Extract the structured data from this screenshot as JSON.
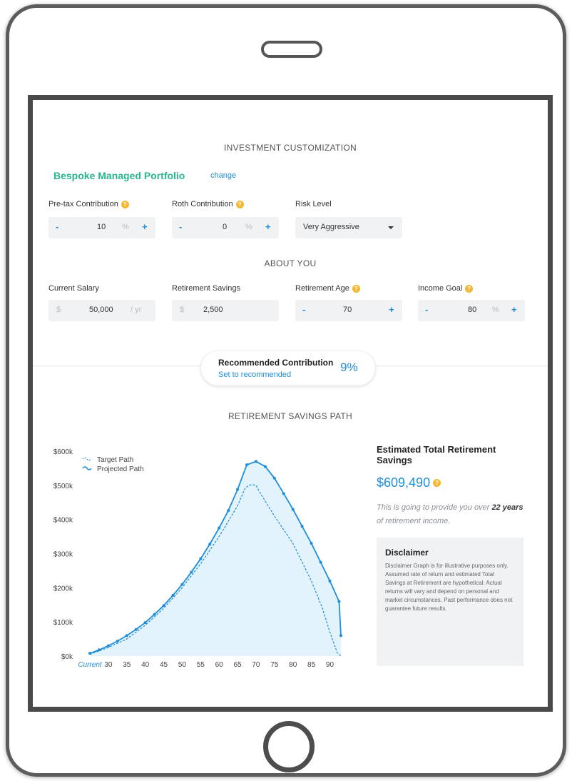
{
  "investment": {
    "title": "INVESTMENT CUSTOMIZATION",
    "portfolio_name": "Bespoke Managed Portfolio",
    "change_label": "change",
    "pretax": {
      "label": "Pre-tax Contribution",
      "minus": "-",
      "value": "10",
      "unit": "%",
      "plus": "+"
    },
    "roth": {
      "label": "Roth Contribution",
      "minus": "-",
      "value": "0",
      "unit": "%",
      "plus": "+"
    },
    "risk": {
      "label": "Risk Level",
      "value": "Very Aggressive"
    }
  },
  "about": {
    "title": "ABOUT YOU",
    "salary": {
      "label": "Current Salary",
      "prefix": "$",
      "value": "50,000",
      "unit": "/ yr"
    },
    "savings": {
      "label": "Retirement Savings",
      "prefix": "$",
      "value": "2,500"
    },
    "retirement_age": {
      "label": "Retirement Age",
      "minus": "-",
      "value": "70",
      "plus": "+"
    },
    "income_goal": {
      "label": "Income Goal",
      "minus": "-",
      "value": "80",
      "unit": "%",
      "plus": "+"
    }
  },
  "recommendation": {
    "title": "Recommended Contribution",
    "link": "Set to recommended",
    "value": "9%"
  },
  "chart_section": {
    "title": "RETIREMENT SAVINGS PATH"
  },
  "estimate": {
    "title": "Estimated Total Retirement Savings",
    "value": "$609,490",
    "note_pre": "This is going to provide you over",
    "years": "22",
    "years_unit": "years",
    "note_post": "of retirement income."
  },
  "disclaimer": {
    "title": "Disclaimer",
    "body": "Disclaimer Graph is for illustrative purposes only. Assumed rate of return and estimated Total Savings at Retirement are hypothetical. Actual returns will vary and depend on personal and market circumstances. Past performance does not guarantee future results."
  },
  "colors": {
    "accent": "#1f8ed8",
    "brand_green": "#2bb58e",
    "help": "#f5b731",
    "fill": "#e3f3fb"
  },
  "chart_data": {
    "type": "area",
    "ylim": [
      0,
      600000
    ],
    "y_ticks": [
      0,
      100000,
      200000,
      300000,
      400000,
      500000,
      600000
    ],
    "y_tick_labels": [
      "$0k",
      "$100k",
      "$200k",
      "$300k",
      "$400k",
      "$500k",
      "$600k"
    ],
    "x_tick_labels": [
      "Current",
      "30",
      "35",
      "40",
      "45",
      "50",
      "55",
      "60",
      "65",
      "70",
      "75",
      "80",
      "85",
      "90"
    ],
    "x_tick_values": [
      25,
      30,
      35,
      40,
      45,
      50,
      55,
      60,
      65,
      70,
      75,
      80,
      85,
      90
    ],
    "xlim": [
      25,
      93
    ],
    "legend": "top-left",
    "series": [
      {
        "name": "Target Path",
        "style": "dashed",
        "x": [
          25,
          30,
          35,
          40,
          45,
          50,
          55,
          60,
          65,
          67,
          68,
          69,
          70,
          71,
          75,
          80,
          85,
          88,
          90,
          92,
          93
        ],
        "y": [
          5000,
          25000,
          50000,
          90000,
          140000,
          200000,
          270000,
          350000,
          440000,
          490000,
          500000,
          502000,
          500000,
          480000,
          410000,
          330000,
          220000,
          140000,
          70000,
          10000,
          0
        ]
      },
      {
        "name": "Projected Path",
        "style": "solid",
        "x": [
          25,
          27.5,
          30,
          32.5,
          35,
          37.5,
          40,
          42.5,
          45,
          47.5,
          50,
          52.5,
          55,
          57.5,
          60,
          62.5,
          65,
          67.5,
          70,
          72.5,
          75,
          77.5,
          80,
          82.5,
          85,
          87.5,
          90,
          92.5,
          93
        ],
        "y": [
          8000,
          18000,
          30000,
          44000,
          60000,
          78000,
          98000,
          122000,
          148000,
          178000,
          210000,
          246000,
          285000,
          328000,
          375000,
          426000,
          488000,
          560000,
          570000,
          555000,
          521000,
          476000,
          430000,
          380000,
          330000,
          275000,
          220000,
          160000,
          60000
        ]
      }
    ]
  }
}
